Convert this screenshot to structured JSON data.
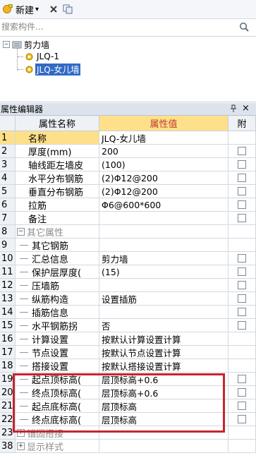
{
  "toolbar": {
    "new_label": "新建",
    "new_dropdown_glyph": "▾",
    "delete_icon": "close-x-icon",
    "copy_icon": "copy-icon"
  },
  "search": {
    "placeholder": "搜索构件..."
  },
  "tree": {
    "root_label": "剪力墙",
    "items": [
      {
        "label": "JLQ-1",
        "selected": false
      },
      {
        "label": "JLQ-女儿墙",
        "selected": true
      }
    ]
  },
  "property_panel": {
    "title": "属性编辑器",
    "pin_glyph": "ᵖ",
    "close_glyph": "×"
  },
  "grid": {
    "header": {
      "name": "属性名称",
      "value": "属性值",
      "attach": "附"
    },
    "rows": [
      {
        "num": "1",
        "name": "名称",
        "value": "JLQ-女儿墙",
        "indent": false,
        "group": false,
        "checkbox": false,
        "selected": true
      },
      {
        "num": "2",
        "name": "厚度(mm)",
        "value": "200",
        "indent": false,
        "group": false,
        "checkbox": true
      },
      {
        "num": "3",
        "name": "轴线距左墙皮",
        "value": "(100)",
        "indent": false,
        "group": false,
        "checkbox": true
      },
      {
        "num": "4",
        "name": "水平分布钢筋",
        "value": "(2)Φ12@200",
        "indent": false,
        "group": false,
        "checkbox": true
      },
      {
        "num": "5",
        "name": "垂直分布钢筋",
        "value": "(2)Φ12@200",
        "indent": false,
        "group": false,
        "checkbox": true
      },
      {
        "num": "6",
        "name": "拉筋",
        "value": "Φ6@600*600",
        "indent": false,
        "group": false,
        "checkbox": true
      },
      {
        "num": "7",
        "name": "备注",
        "value": "",
        "indent": false,
        "group": false,
        "checkbox": true
      },
      {
        "num": "8",
        "name": "其它属性",
        "value": "",
        "indent": false,
        "group": true,
        "checkbox": false,
        "expander": "−"
      },
      {
        "num": "9",
        "name": "其它钢筋",
        "value": "",
        "indent": true,
        "group": false,
        "checkbox": false
      },
      {
        "num": "10",
        "name": "汇总信息",
        "value": "剪力墙",
        "indent": true,
        "group": false,
        "checkbox": true
      },
      {
        "num": "11",
        "name": "保护层厚度(",
        "value": "(15)",
        "indent": true,
        "group": false,
        "checkbox": true
      },
      {
        "num": "12",
        "name": "压墙筋",
        "value": "",
        "indent": true,
        "group": false,
        "checkbox": true
      },
      {
        "num": "13",
        "name": "纵筋构造",
        "value": "设置插筋",
        "indent": true,
        "group": false,
        "checkbox": true
      },
      {
        "num": "14",
        "name": "插筋信息",
        "value": "",
        "indent": true,
        "group": false,
        "checkbox": true
      },
      {
        "num": "15",
        "name": "水平钢筋拐",
        "value": "否",
        "indent": true,
        "group": false,
        "checkbox": true
      },
      {
        "num": "16",
        "name": "计算设置",
        "value": "按默认计算设置计算",
        "indent": true,
        "group": false,
        "checkbox": false
      },
      {
        "num": "17",
        "name": "节点设置",
        "value": "按默认节点设置计算",
        "indent": true,
        "group": false,
        "checkbox": false
      },
      {
        "num": "18",
        "name": "搭接设置",
        "value": "按默认搭接设置计算",
        "indent": true,
        "group": false,
        "checkbox": false
      },
      {
        "num": "19",
        "name": "起点顶标高(",
        "value": "层顶标高+0.6",
        "indent": true,
        "group": false,
        "checkbox": true
      },
      {
        "num": "20",
        "name": "终点顶标高(",
        "value": "层顶标高+0.6",
        "indent": true,
        "group": false,
        "checkbox": true
      },
      {
        "num": "21",
        "name": "起点底标高(",
        "value": "层顶标高",
        "indent": true,
        "group": false,
        "checkbox": true
      },
      {
        "num": "22",
        "name": "终点底标高(",
        "value": "层顶标高",
        "indent": true,
        "group": false,
        "checkbox": true
      },
      {
        "num": "23",
        "name": "锚固搭接",
        "value": "",
        "indent": false,
        "group": true,
        "checkbox": false,
        "expander": "+"
      },
      {
        "num": "38",
        "name": "显示样式",
        "value": "",
        "indent": false,
        "group": true,
        "checkbox": false,
        "expander": "+"
      }
    ]
  },
  "colors": {
    "highlight": "#c8232c",
    "selected": "#ffe08a",
    "header_value": "#ffe08a"
  }
}
